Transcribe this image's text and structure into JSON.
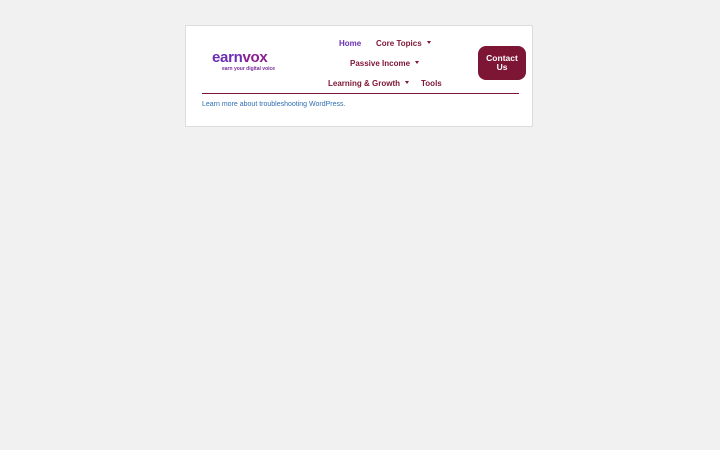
{
  "logo": {
    "word_main": "earn",
    "word_tail": "vox",
    "tagline": "earn your digital voice"
  },
  "nav": {
    "items": [
      {
        "label": "Home",
        "has_dropdown": false,
        "active": true
      },
      {
        "label": "Core Topics",
        "has_dropdown": true,
        "active": false
      },
      {
        "label": "Passive Income",
        "has_dropdown": true,
        "active": false
      },
      {
        "label": "Learning & Growth",
        "has_dropdown": true,
        "active": false
      },
      {
        "label": "Tools",
        "has_dropdown": false,
        "active": false
      }
    ]
  },
  "contact_button": {
    "label": "Contact Us"
  },
  "help": {
    "link_text": "Learn more about troubleshooting WordPress."
  },
  "colors": {
    "page_background": "#f1f1f1",
    "brand_primary": "#7d1535",
    "brand_purple": "#6b2fb3",
    "link": "#2f6db3"
  }
}
